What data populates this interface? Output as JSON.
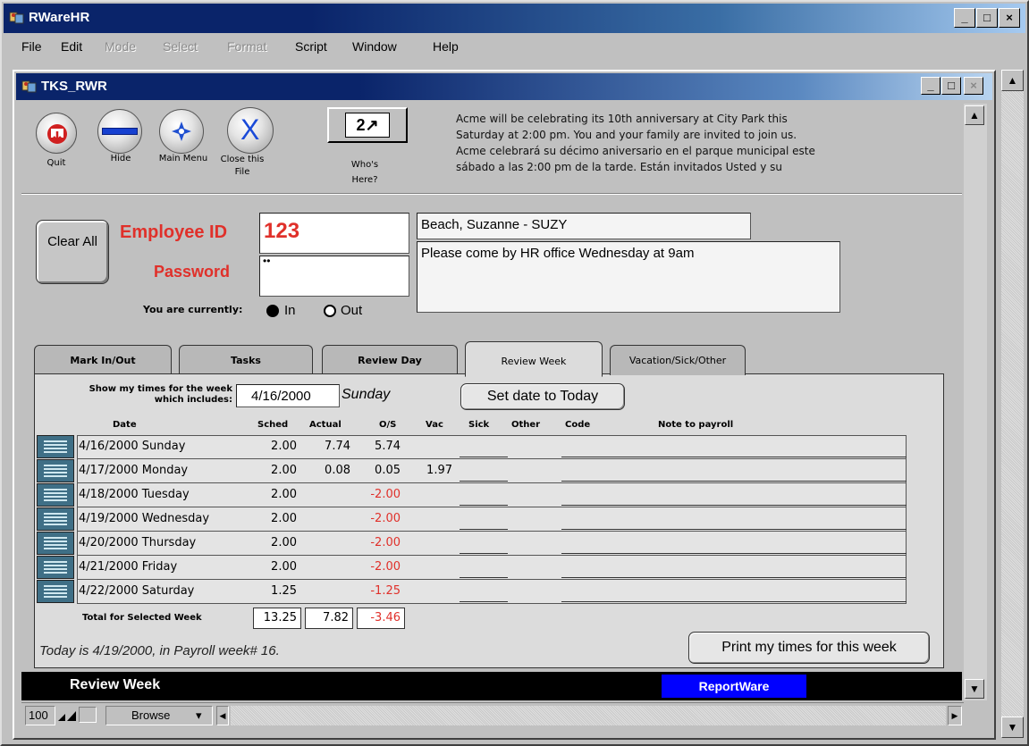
{
  "app": {
    "title": "RWareHR",
    "window_buttons": [
      "_",
      "□",
      "×"
    ],
    "menu": [
      {
        "label": "File",
        "enabled": true
      },
      {
        "label": "Edit",
        "enabled": true
      },
      {
        "label": "Mode",
        "enabled": false
      },
      {
        "label": "Select",
        "enabled": false
      },
      {
        "label": "Format",
        "enabled": false
      },
      {
        "label": "Script",
        "enabled": true
      },
      {
        "label": "Window",
        "enabled": true
      },
      {
        "label": "Help",
        "enabled": true
      }
    ]
  },
  "document": {
    "title": "TKS_RWR"
  },
  "toolbar": {
    "quit_label": "Quit",
    "hide_label": "Hide",
    "main_menu_label": "Main Menu",
    "close_file_label": "Close this File",
    "whos_here_label": "Who's Here?",
    "whos_here_icon_text": "2↗"
  },
  "announcement": [
    "Acme will be celebrating its 10th anniversary at City Park this",
    "Saturday at 2:00 pm.  You and your family are invited to join us.",
    "Acme celebrará su  décimo aniversario en el parque municipal este",
    "sábado a las 2:00 pm de la tarde.  Están invitados Usted y su"
  ],
  "login": {
    "clear_all_label": "Clear All",
    "employee_id_label": "Employee ID",
    "employee_id_value": "123",
    "password_label": "Password",
    "password_value": "••",
    "status_prefix": "You are currently:",
    "status_in": "In",
    "status_out": "Out",
    "status_selected": "In"
  },
  "employee": {
    "name": "Beach, Suzanne  - SUZY",
    "message": "Please come by HR office Wednesday at 9am"
  },
  "tabs": [
    {
      "label": "Mark In/Out",
      "active": false
    },
    {
      "label": "Tasks",
      "active": false
    },
    {
      "label": "Review Day",
      "active": false
    },
    {
      "label": "Review Week",
      "active": true
    },
    {
      "label": "Vacation/Sick/Other",
      "active": false
    }
  ],
  "week": {
    "show_label_1": "Show my times for the week",
    "show_label_2": "which includes:",
    "date_value": "4/16/2000",
    "day_value": "Sunday",
    "set_today_label": "Set date to Today",
    "columns": {
      "date": "Date",
      "sched": "Sched",
      "actual": "Actual",
      "os": "O/S",
      "vac": "Vac",
      "sick": "Sick",
      "other": "Other",
      "code": "Code",
      "note": "Note to payroll"
    },
    "rows": [
      {
        "date": "4/16/2000 Sunday",
        "sched": "2.00",
        "actual": "7.74",
        "os": "5.74",
        "os_negative": false,
        "vac": ""
      },
      {
        "date": "4/17/2000 Monday",
        "sched": "2.00",
        "actual": "0.08",
        "os": "0.05",
        "os_negative": false,
        "vac": "1.97"
      },
      {
        "date": "4/18/2000 Tuesday",
        "sched": "2.00",
        "actual": "",
        "os": "-2.00",
        "os_negative": true,
        "vac": ""
      },
      {
        "date": "4/19/2000 Wednesday",
        "sched": "2.00",
        "actual": "",
        "os": "-2.00",
        "os_negative": true,
        "vac": ""
      },
      {
        "date": "4/20/2000 Thursday",
        "sched": "2.00",
        "actual": "",
        "os": "-2.00",
        "os_negative": true,
        "vac": ""
      },
      {
        "date": "4/21/2000 Friday",
        "sched": "2.00",
        "actual": "",
        "os": "-2.00",
        "os_negative": true,
        "vac": ""
      },
      {
        "date": "4/22/2000 Saturday",
        "sched": "1.25",
        "actual": "",
        "os": "-1.25",
        "os_negative": true,
        "vac": ""
      }
    ],
    "total_label": "Total for Selected Week",
    "total_sched": "13.25",
    "total_actual": "7.82",
    "total_os": "-3.46",
    "today_text": "Today is 4/19/2000, in Payroll week# 16.",
    "print_label": "Print my times for this week"
  },
  "status_bar": {
    "left": "Review Week",
    "right": "ReportWare",
    "right_bg": "#0000ff"
  },
  "bottom_bar": {
    "zoom": "100",
    "mode": "Browse"
  },
  "colors": {
    "red_label": "#e0302a",
    "title_blue": "#0a246a"
  }
}
